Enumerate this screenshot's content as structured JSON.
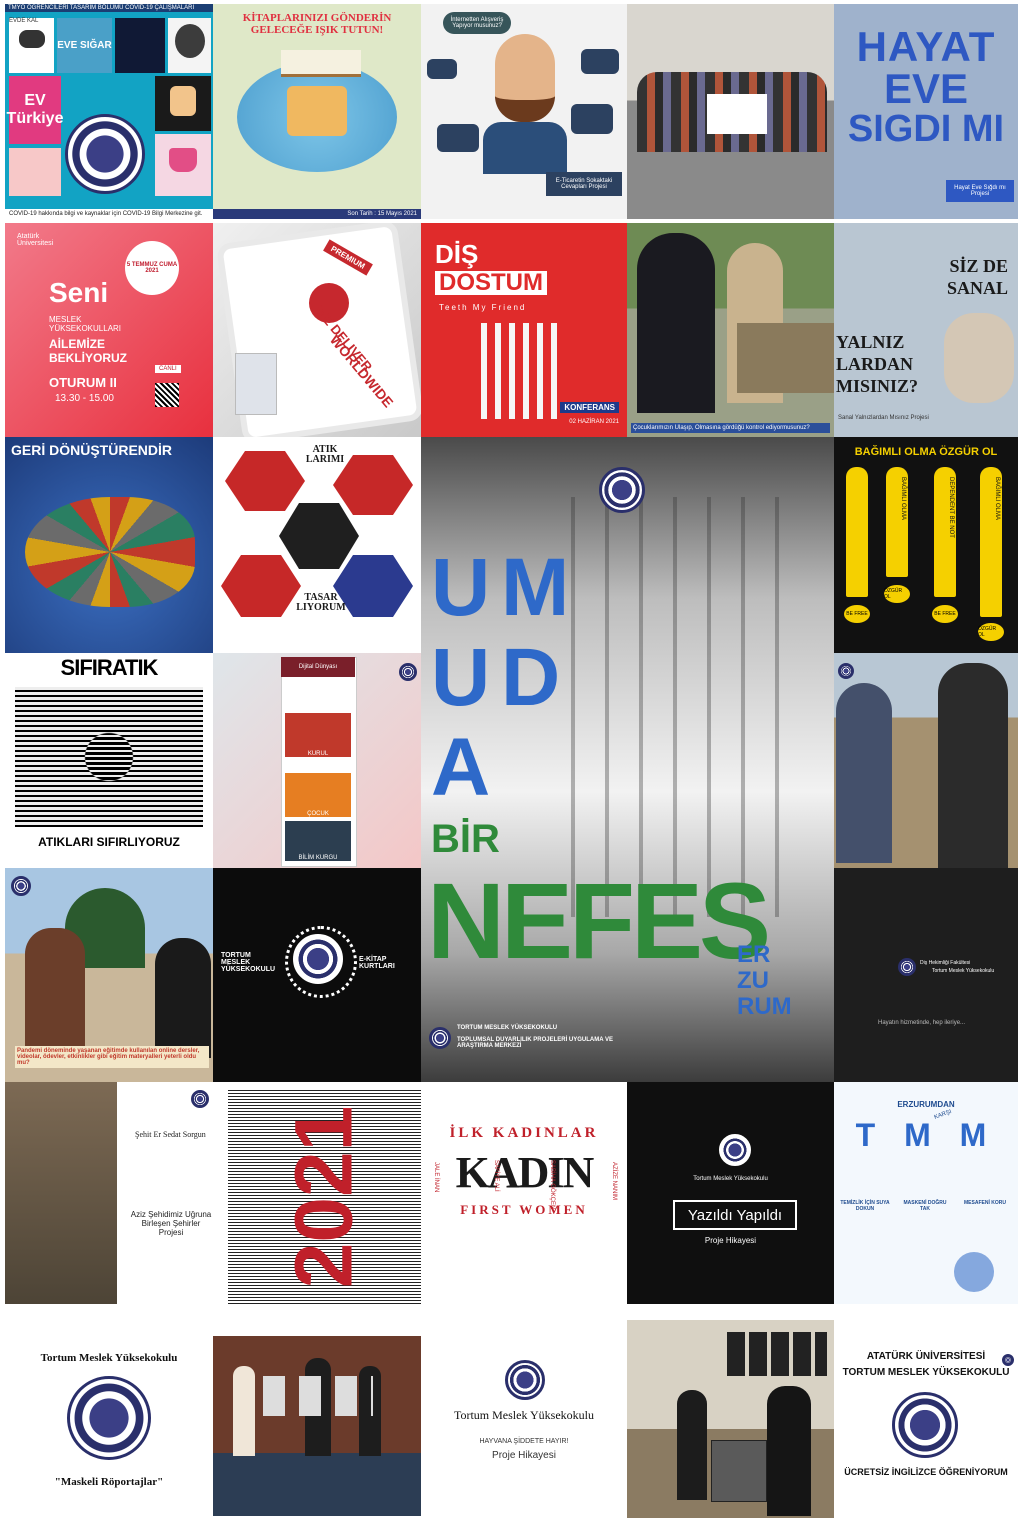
{
  "tiles": {
    "r1c1": {
      "header": "TMYO ÖĞRENCİLERİ TASARIM BÖLÜMÜ COVID-19 ÇALIŞMALARI",
      "badge1": "EVDE KAL",
      "badge2": "EVE SIĞAR",
      "badge3": "EV Türkiye",
      "footer": "COVID-19 hakkında bilgi ve kaynaklar için COVID-19 Bilgi Merkezine git."
    },
    "r1c2": {
      "title": "KİTAPLARINIZI GÖNDERİN GELECEĞE IŞIK TUTUN!",
      "bottom": "Son Tarih : 15 Mayıs 2021"
    },
    "r1c3": {
      "bubble": "İnternetten Alışveriş Yapıyor musunuz?",
      "caption": "E-Ticaretin Sokaktaki Cevapları Projesi"
    },
    "r1c5": {
      "line1": "HAYAT",
      "line2": "EVE",
      "line3": "SIGDI MI",
      "caption": "Hayat Eve Sığdı mı Projesi"
    },
    "r2c1": {
      "brand": "Atatürk Üniversitesi",
      "date": "5 TEMMUZ CUMA 2021",
      "headline": "Seni",
      "sub1": "MESLEK YÜKSEKOKULLARI",
      "sub2": "AİLEMİZE BEKLİYORUZ",
      "session": "OTURUM II",
      "time": "13.30 - 15.00",
      "live": "CANLI"
    },
    "r2c2": {
      "stamp": "PREMIUM",
      "slogan1": "WE DELIVER",
      "slogan2": "WORLDWIDE"
    },
    "r2c3": {
      "title1": "DİŞ",
      "title2": "DOSTUM",
      "sub": "Teeth My Friend",
      "event": "KONFERANS",
      "date": "02 HAZİRAN 2021"
    },
    "r2c4": {
      "banner": "Çocuklarımızın Ulaşıp, Olmasına gördüğü kontrol ediyormusunuz?"
    },
    "r2c5": {
      "l1": "SİZ DE",
      "l2": "SANAL",
      "l3": "YALNIZ",
      "l4": "LARDAN",
      "l5": "MISINIZ?",
      "caption": "Sanal Yalnızlardan Mısınız Projesi"
    },
    "r3c1": {
      "title": "GERİ DÖNÜŞTÜRENDİR"
    },
    "r3c2": {
      "words1": "ATIK LARIMI",
      "words2": "TASAR LIYORUM"
    },
    "center": {
      "u": "U",
      "m": "M",
      "u2": "U",
      "d": "D",
      "a": "A",
      "bir": "BİR",
      "nefes": "NEFES",
      "er": "ER",
      "zu": "ZU",
      "rum": "RUM",
      "school": "TORTUM MESLEK YÜKSEKOKULU",
      "center": "TOPLUMSAL DUYARLILIK PROJELERİ UYGULAMA VE ARAŞTIRMA MERKEZİ"
    },
    "r3c5": {
      "title": "BAĞIMLI OLMA ÖZGÜR OL",
      "v1": "BAĞIMLI OLMA",
      "v2": "DEPENDENT BE NOT",
      "v3": "BAĞIMLI OLMA",
      "f1": "BE FREE",
      "f2": "ÖZGÜR OL",
      "f3": "BE FREE",
      "f4": "ÖZGÜR OL"
    },
    "r4c1": {
      "word": "SIFIRATIK",
      "bottom": "ATIKLARI SIFIRLIYORUZ"
    },
    "r4c2": {
      "label1": "Dijital Dünyası",
      "label2": "KURUL",
      "label3": "ÇOCUK",
      "label4": "BİLİM KURGU"
    },
    "r5c1": {
      "banner": "Pandemi döneminde yaşanan eğitimde kullanılan online dersler, videolar, ödevler, etkinlikler gibi eğitim materyalleri yeterli oldu mu?"
    },
    "r5c2": {
      "left": "TORTUM MESLEK YÜKSEKOKULU",
      "right": "E-KİTAP KURTLARI"
    },
    "r5c5": {
      "title": "Diş Hekimliği Fakültesi",
      "sub": "Tortum Meslek Yüksekokulu",
      "tagline": "Hayatın hizmetinde, hep ileriye..."
    },
    "r6c1": {
      "title": "Şehit Er Sedat Sorgun",
      "sub": "Aziz Şehidimiz Uğruna Birleşen Şehirler Projesi"
    },
    "r6c2": {
      "year": "2021"
    },
    "r6c3": {
      "top": "İLK KADINLAR",
      "center": "KADIN",
      "bottom": "FIRST WOMEN",
      "n1": "JALE İNAN",
      "n2": "SAFİYE ALİ",
      "n3": "SABİHA GÖKÇEN",
      "n4": "AZİZE NANIM"
    },
    "r6c4": {
      "school": "Tortum Meslek Yüksekokulu",
      "title": "Yazıldı Yapıldı",
      "sub": "Proje Hikayesi"
    },
    "r6c5": {
      "top": "ERZURUMDAN",
      "karsi": "KARŞI",
      "letters": "T M M",
      "c1": "TEMİZLİK İÇİN SUYA DOKUN",
      "c2": "MASKENİ DOĞRU TAK",
      "c3": "MESAFENİ KORU"
    },
    "r7c1": {
      "school": "Tortum Meslek Yüksekokulu",
      "title": "\"Maskeli Röportajlar\""
    },
    "r7c3": {
      "school": "Tortum Meslek Yüksekokulu",
      "sub": "HAYVANA ŞİDDETE HAYIR!",
      "caption": "Proje Hikayesi"
    },
    "r7c5": {
      "l1": "ATATÜRK ÜNİVERSİTESİ",
      "l2": "TORTUM MESLEK YÜKSEKOKULU",
      "l3": "ÜCRETSİZ İNGİLİZCE ÖĞRENİYORUM"
    }
  },
  "colors": {
    "accent_blue": "#2e69c9",
    "accent_green": "#2f8a3a",
    "navy": "#2a2f6b",
    "red": "#d62828"
  }
}
